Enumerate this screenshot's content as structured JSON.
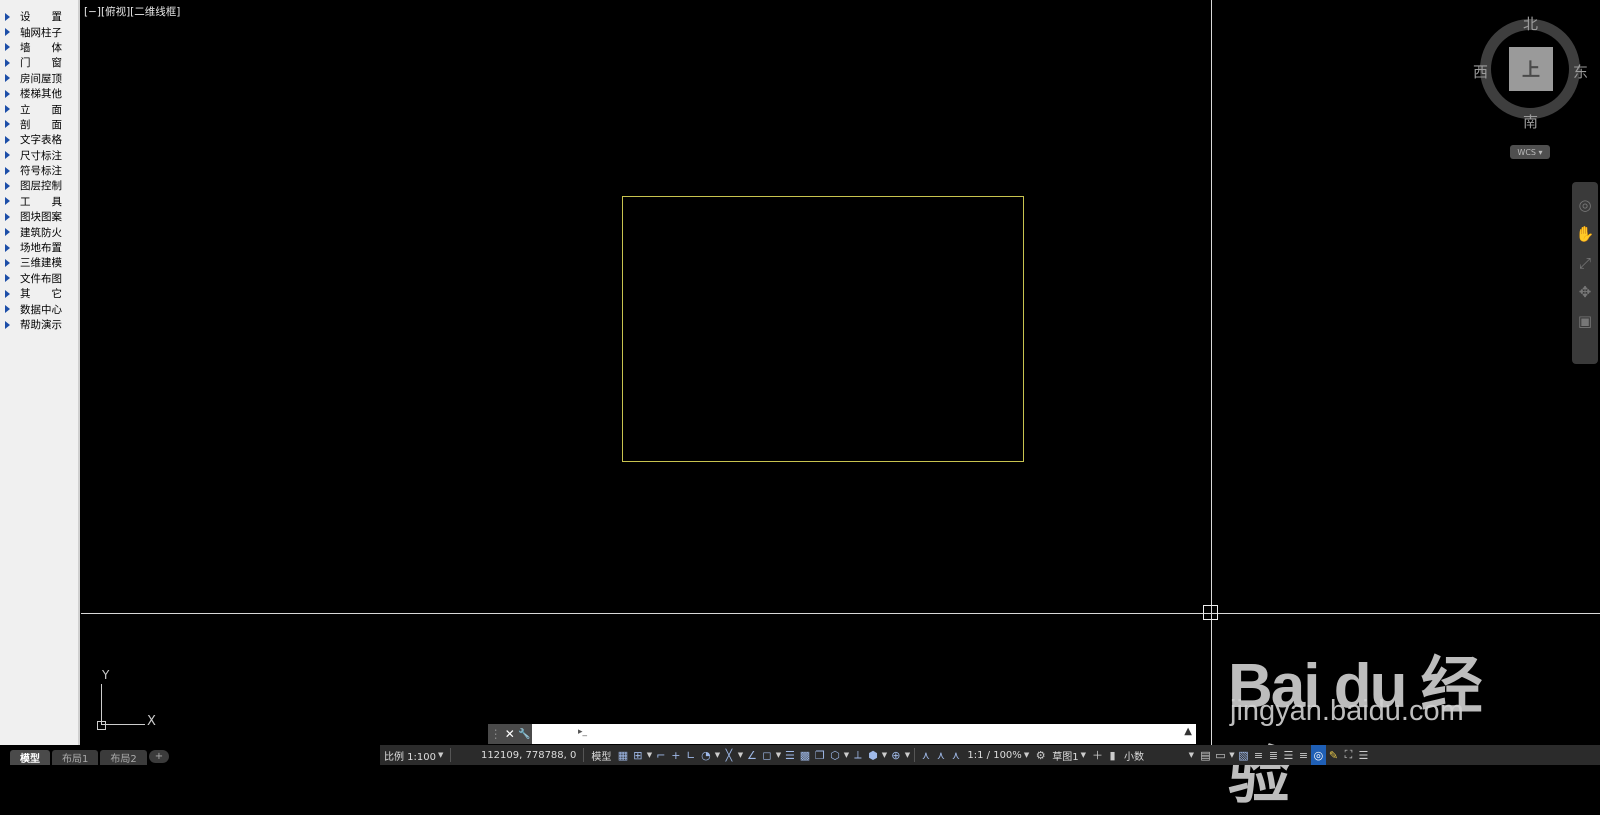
{
  "sidebar": {
    "items": [
      {
        "label": "设　　置"
      },
      {
        "label": "轴网柱子"
      },
      {
        "label": "墙　　体"
      },
      {
        "label": "门　　窗"
      },
      {
        "label": "房间屋顶"
      },
      {
        "label": "楼梯其他"
      },
      {
        "label": "立　　面"
      },
      {
        "label": "剖　　面"
      },
      {
        "label": "文字表格"
      },
      {
        "label": "尺寸标注"
      },
      {
        "label": "符号标注"
      },
      {
        "label": "图层控制"
      },
      {
        "label": "工　　具"
      },
      {
        "label": "图块图案"
      },
      {
        "label": "建筑防火"
      },
      {
        "label": "场地布置"
      },
      {
        "label": "三维建模"
      },
      {
        "label": "文件布图"
      },
      {
        "label": "其　　它"
      },
      {
        "label": "数据中心"
      },
      {
        "label": "帮助演示"
      }
    ]
  },
  "viewport": {
    "label": "[−][俯视][二维线框]",
    "background": "#000000",
    "rectangle_color": "#c8c34f"
  },
  "ucs": {
    "x_label": "X",
    "y_label": "Y"
  },
  "viewcube": {
    "north": "北",
    "south": "南",
    "east": "东",
    "west": "西",
    "face_glyph": "上",
    "wcs_label": "WCS ▾"
  },
  "navbar": {
    "icons": [
      "steering-wheel-icon",
      "pan-icon",
      "zoom-extents-icon",
      "orbit-icon",
      "showmotion-icon"
    ]
  },
  "tabs": [
    {
      "label": "模型",
      "active": true
    },
    {
      "label": "布局1",
      "active": false
    },
    {
      "label": "布局2",
      "active": false
    },
    {
      "label": "+",
      "active": false
    }
  ],
  "cmdline": {
    "close_glyph": "✕",
    "settings_glyph": "🔧",
    "prompt_glyph": "▸_",
    "value": "",
    "arrow": "▲"
  },
  "statusbar": {
    "scale": "比例 1:100",
    "coords": "112109, 778788, 0",
    "model": "模型",
    "annotation_scale": "1:1 / 100%",
    "workspace": "草图1",
    "units": "小数"
  },
  "watermark": {
    "brand": "Bai du 经验",
    "url": "jingyan.baidu.com"
  }
}
